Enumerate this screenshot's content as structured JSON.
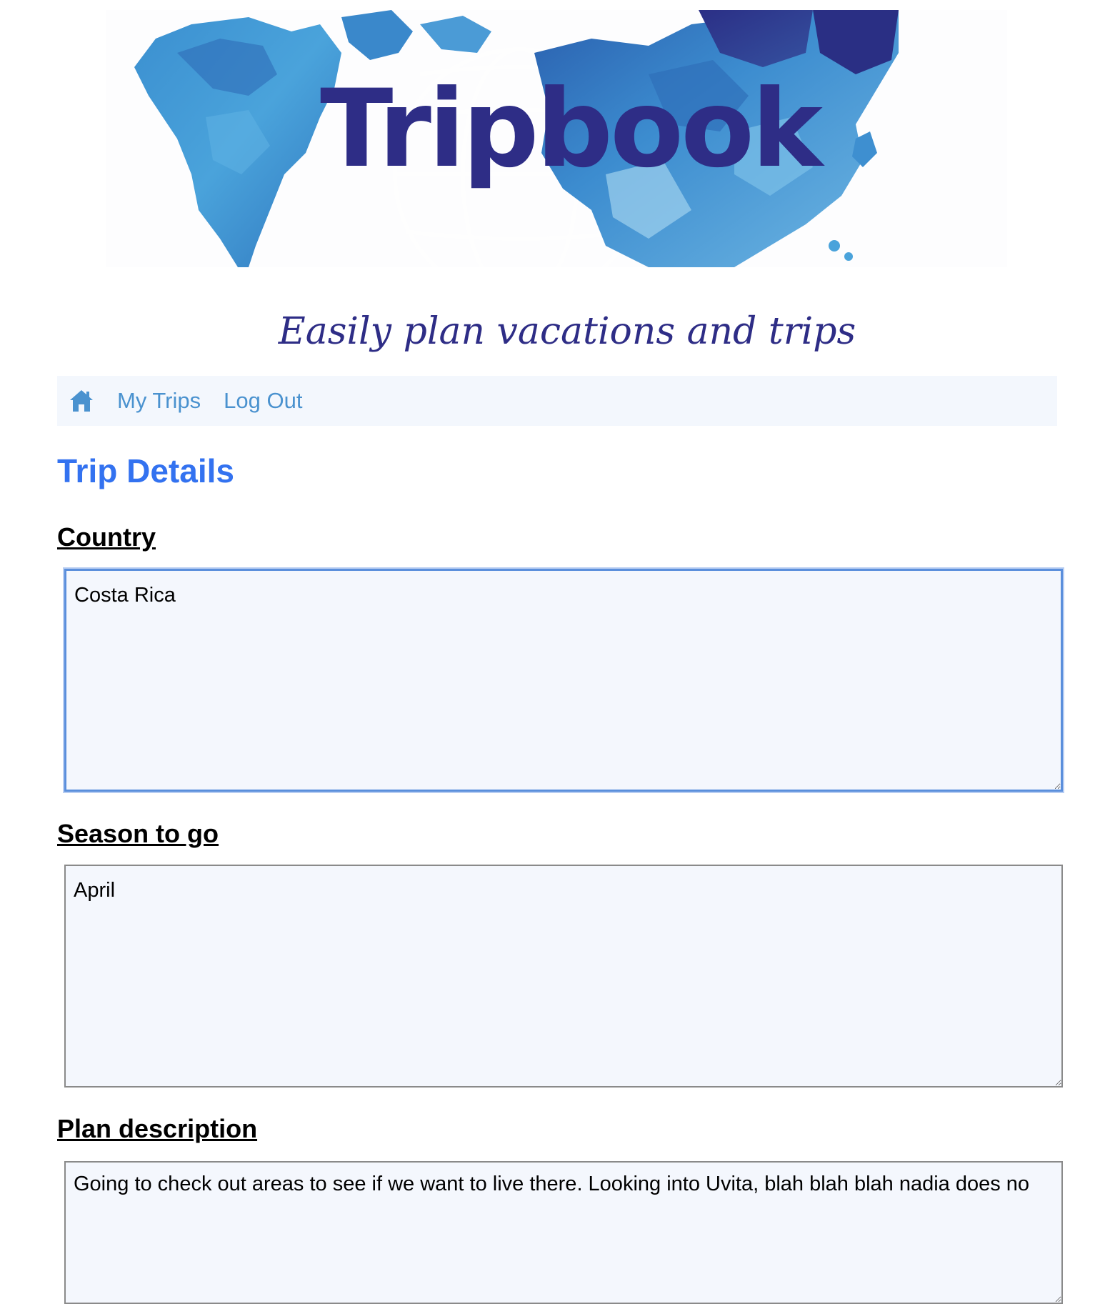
{
  "banner": {
    "brand_text": "Tripbook",
    "image": "world-map-banner"
  },
  "tagline": "Easily plan vacations and trips",
  "nav": {
    "home_icon": "home-icon",
    "items": [
      {
        "label": "My Trips"
      },
      {
        "label": "Log Out"
      }
    ]
  },
  "page": {
    "title": "Trip Details"
  },
  "fields": {
    "country": {
      "label": "Country",
      "value": "Costa Rica"
    },
    "season": {
      "label": "Season to go",
      "value": "April"
    },
    "plan": {
      "label": "Plan description",
      "value": "Going to check out areas to see if we want to live there. Looking into Uvita, blah blah blah nadia does no"
    }
  },
  "colors": {
    "brand_navy": "#2e2d86",
    "nav_link": "#4a92cf",
    "title_blue": "#3372f0",
    "nav_bg": "#f3f7fd",
    "field_bg": "#f4f7fd"
  }
}
